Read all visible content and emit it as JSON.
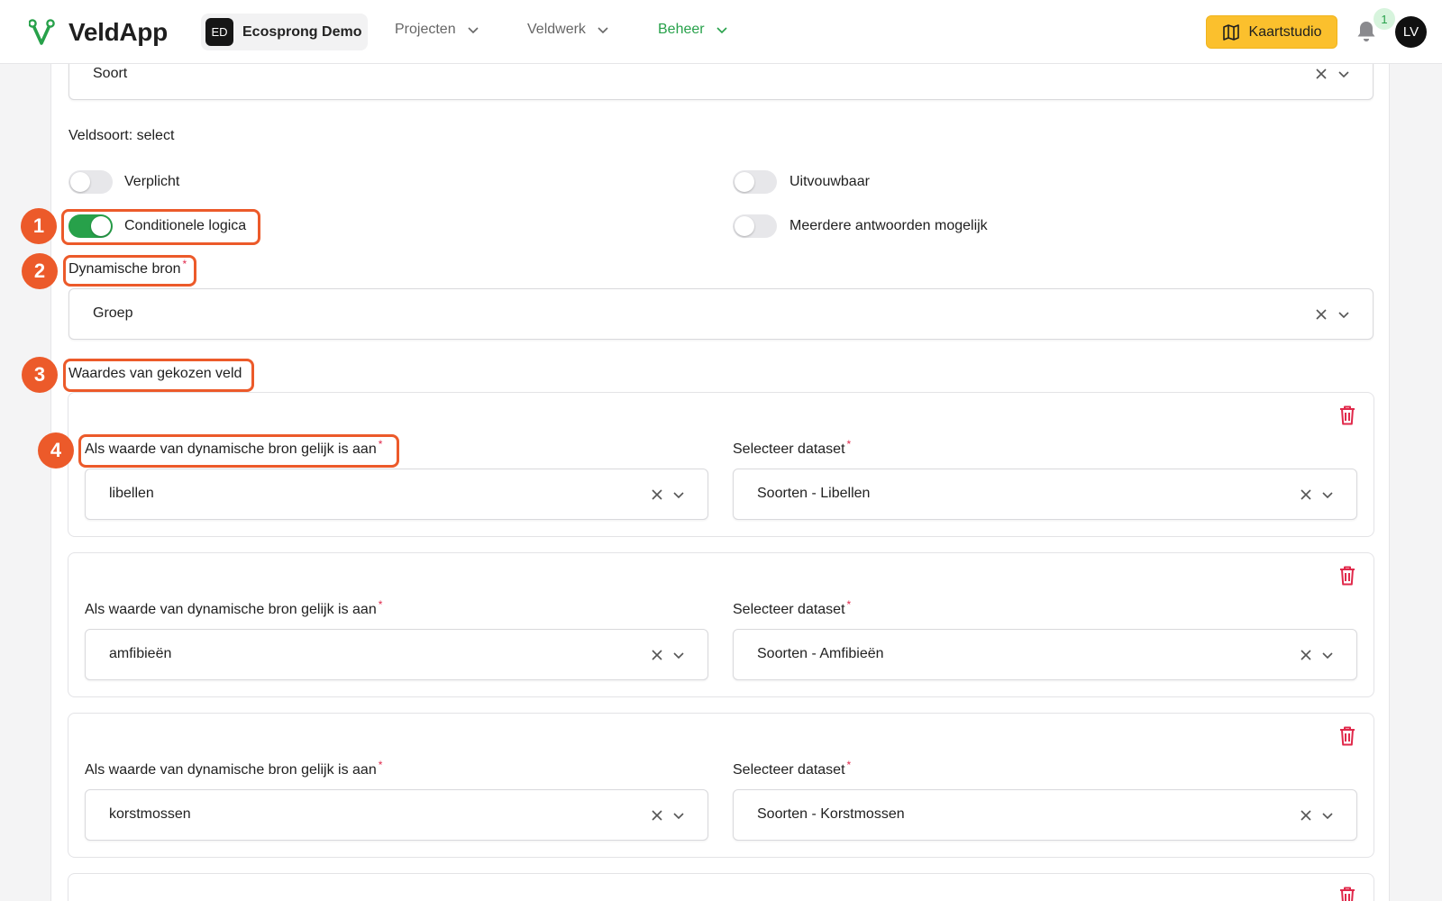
{
  "app": {
    "name": "VeldApp",
    "org_initials": "ED",
    "org_name": "Ecosprong Demo"
  },
  "nav": {
    "projecten": "Projecten",
    "veldwerk": "Veldwerk",
    "beheer": "Beheer",
    "active": "Beheer"
  },
  "header_actions": {
    "map_button": "Kaartstudio",
    "notification_count": "1",
    "avatar_initials": "LV"
  },
  "form": {
    "top_select_value": "Soort",
    "field_type": "Veldsoort: select",
    "toggles": {
      "verplicht": {
        "label": "Verplicht",
        "on": false
      },
      "uitvouwbaar": {
        "label": "Uitvouwbaar",
        "on": false
      },
      "conditionele_logica": {
        "label": "Conditionele logica",
        "on": true
      },
      "meerdere": {
        "label": "Meerdere antwoorden mogelijk",
        "on": false
      }
    },
    "dynamic_source_label": "Dynamische bron",
    "dynamic_source_value": "Groep",
    "values_section_label": "Waardes van gekozen veld",
    "condition_label": "Als waarde van dynamische bron gelijk is aan",
    "dataset_label": "Selecteer dataset",
    "required_mark": "*",
    "rules": [
      {
        "value": "libellen",
        "dataset": "Soorten - Libellen"
      },
      {
        "value": "amfibieën",
        "dataset": "Soorten - Amfibieën"
      },
      {
        "value": "korstmossen",
        "dataset": "Soorten - Korstmossen"
      }
    ]
  },
  "annotations": [
    "1",
    "2",
    "3",
    "4"
  ],
  "colors": {
    "brand_green": "#27a14a",
    "annotation_orange": "#ec5a2a",
    "map_button_yellow": "#fbc02d",
    "delete_red": "#e0284a"
  }
}
